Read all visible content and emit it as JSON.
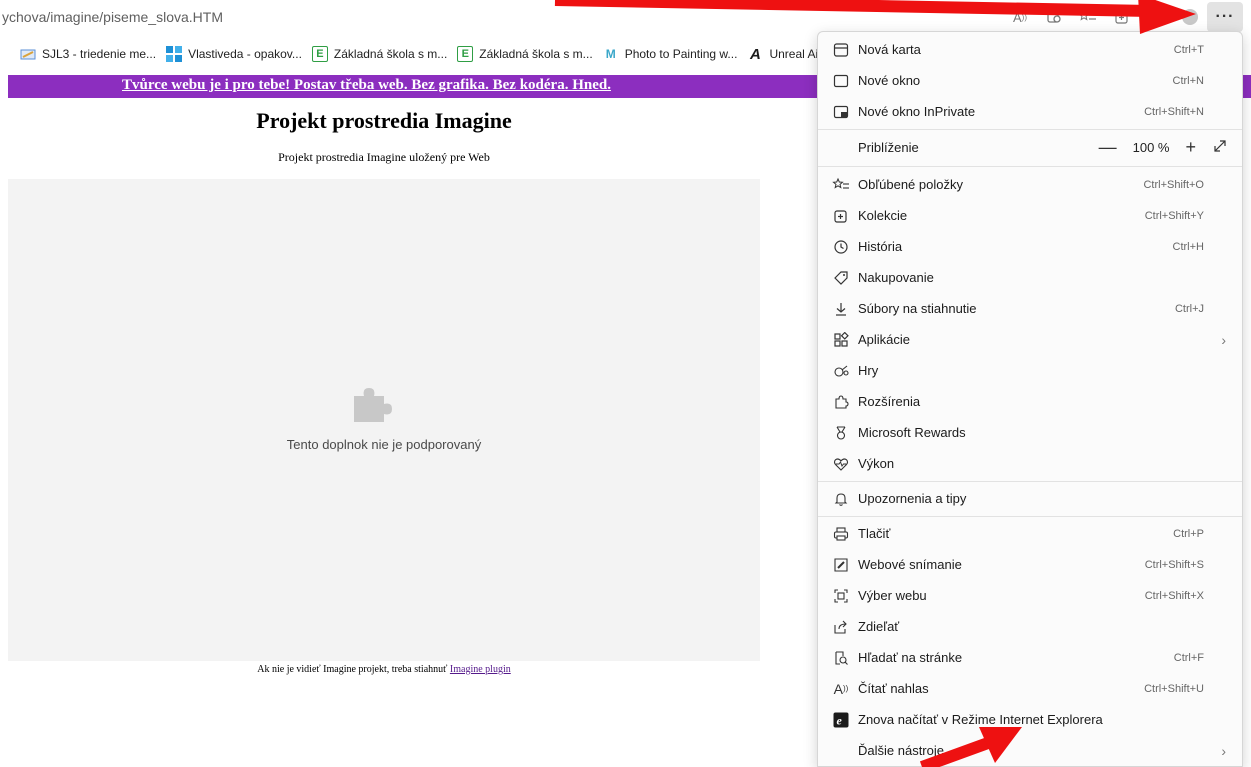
{
  "browser": {
    "url": "ychova/imagine/piseme_slova.HTM",
    "toolbar_icons": [
      "read-aloud-icon",
      "tab-action-icon",
      "favorites-icon",
      "collections-icon",
      "copilot-icon",
      "profile-icon"
    ],
    "menu_button_label": "···"
  },
  "bookmarks": [
    {
      "label": "SJL3 - triedenie me...",
      "icon": "pencil-icon",
      "color": "#5b8fd6"
    },
    {
      "label": "Vlastiveda - opakov...",
      "icon": "grid-icon",
      "color": "#1e90d6"
    },
    {
      "label": "Základná škola s m...",
      "icon": "e-icon",
      "color": "#2f9e44"
    },
    {
      "label": "Základná škola s m...",
      "icon": "e-icon",
      "color": "#2f9e44"
    },
    {
      "label": "Photo to Painting w...",
      "icon": "m-icon",
      "color": "#3aa7c9"
    },
    {
      "label": "Unreal Ai",
      "icon": "a-icon",
      "color": "#1b1b1b"
    }
  ],
  "page": {
    "banner_link": "Tvůrce webu je i pro tebe! Postav třeba web. Bez grafika. Bez kodéra. Hned.",
    "title": "Projekt prostredia Imagine",
    "subtitle": "Projekt prostredia Imagine uložený pre Web",
    "plugin_message": "Tento doplnok nie je podporovaný",
    "footer_text": "Ak nie je vidieť Imagine projekt, treba stiahnuť ",
    "footer_link": "Imagine plugin"
  },
  "menu": {
    "zoom_label": "Priblíženie",
    "zoom_value": "100 %",
    "items": [
      {
        "label": "Nová karta",
        "shortcut": "Ctrl+T"
      },
      {
        "label": "Nové okno",
        "shortcut": "Ctrl+N"
      },
      {
        "label": "Nové okno InPrivate",
        "shortcut": "Ctrl+Shift+N"
      },
      {
        "label": "Obľúbené položky",
        "shortcut": "Ctrl+Shift+O"
      },
      {
        "label": "Kolekcie",
        "shortcut": "Ctrl+Shift+Y"
      },
      {
        "label": "História",
        "shortcut": "Ctrl+H"
      },
      {
        "label": "Nakupovanie",
        "shortcut": ""
      },
      {
        "label": "Súbory na stiahnutie",
        "shortcut": "Ctrl+J"
      },
      {
        "label": "Aplikácie",
        "shortcut": ""
      },
      {
        "label": "Hry",
        "shortcut": ""
      },
      {
        "label": "Rozšírenia",
        "shortcut": ""
      },
      {
        "label": "Microsoft Rewards",
        "shortcut": ""
      },
      {
        "label": "Výkon",
        "shortcut": ""
      },
      {
        "label": "Upozornenia a tipy",
        "shortcut": ""
      },
      {
        "label": "Tlačiť",
        "shortcut": "Ctrl+P"
      },
      {
        "label": "Webové snímanie",
        "shortcut": "Ctrl+Shift+S"
      },
      {
        "label": "Výber webu",
        "shortcut": "Ctrl+Shift+X"
      },
      {
        "label": "Zdieľať",
        "shortcut": ""
      },
      {
        "label": "Hľadať na stránke",
        "shortcut": "Ctrl+F"
      },
      {
        "label": "Čítať nahlas",
        "shortcut": "Ctrl+Shift+U"
      },
      {
        "label": "Znova načítať v Režime Internet Explorera",
        "shortcut": ""
      },
      {
        "label": "Ďalšie nástroje",
        "shortcut": ""
      }
    ]
  },
  "annotation": {
    "arrow_color": "#ee1111"
  }
}
